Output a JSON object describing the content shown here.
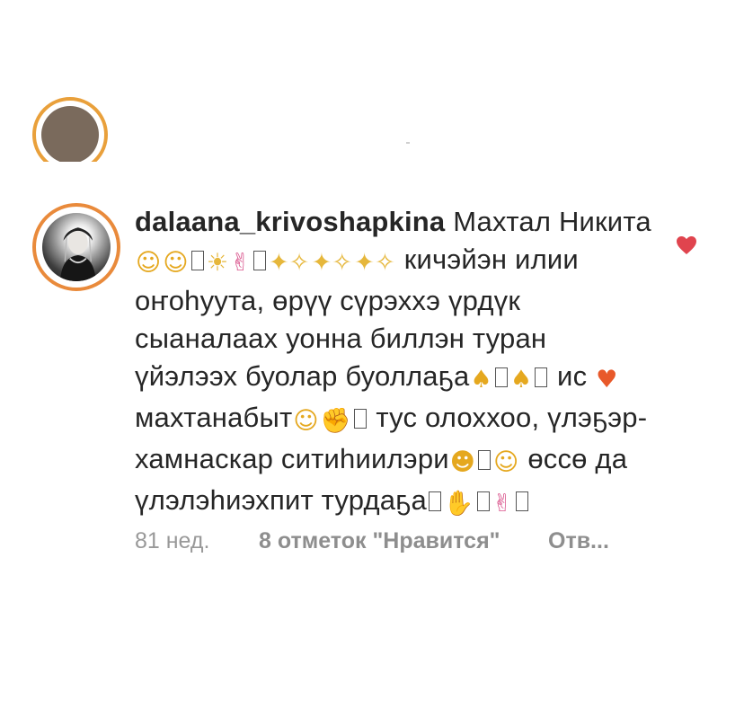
{
  "comment": {
    "username": "dalaana_krivoshapkina",
    "text_segments": {
      "s1": " Махтал Никита ",
      "s2": " кичэйэн илии оҥоһуута, өрүү сүрэххэ үрдүк сыаналаах уонна биллэн туран үйэлээх буолар буоллаҕа",
      "s3": " ис ",
      "s4": " махтанабыт",
      "s5": " тус олоххоо, үлэҕэр-хамнаскар ситиһиилэри",
      "s6": " өссө да үлэлэһиэхпит турдаҕа"
    },
    "icons": {
      "heart_eyes": "heart-eyes-icon",
      "smile": "smiling-face-icon",
      "sun": "sun-icon",
      "thumbs_up": "thumbs-up-icon",
      "sparkles": "sparkles-icon",
      "folded_hands": "folded-hands-icon",
      "orange_heart": "orange-heart-icon",
      "fist": "raised-fist-icon",
      "raising_hands": "raising-hands-icon",
      "clap": "clapping-hands-icon"
    },
    "meta": {
      "time": "81 нед.",
      "likes": "8 отметок \"Нравится\"",
      "reply": "Отв..."
    },
    "like_color": "#e0444e"
  },
  "colors": {
    "avatar_ring": "#e98a3b",
    "meta_text": "#8e8e8e"
  }
}
